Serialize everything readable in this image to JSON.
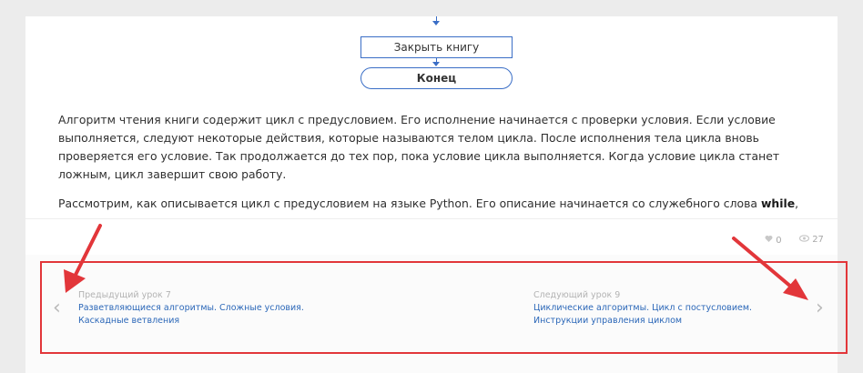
{
  "flowchart": {
    "close_book": "Закрыть книгу",
    "end": "Конец"
  },
  "article": {
    "paragraph1": "Алгоритм чтения книги содержит цикл с предусловием. Его исполнение начинается с проверки условия. Если условие выполняется, следуют некоторые действия, которые называются телом цикла. После исполнения тела цикла вновь проверяется его условие. Так продолжается до тех пор, пока условие цикла выполняется. Когда условие цикла станет ложным, цикл завершит свою работу.",
    "paragraph2_text": "Рассмотрим, как описывается цикл с предусловием на языке Python. Его описание начинается со служебного слова",
    "paragraph2_keyword": "while",
    "paragraph2_tail": ","
  },
  "meta": {
    "likes": "0",
    "views": "27"
  },
  "navigation": {
    "prev_caption": "Предыдущий урок 7",
    "prev_title_line1": "Разветвляющиеся алгоритмы. Сложные условия.",
    "prev_title_line2": "Каскадные ветвления",
    "next_caption": "Следующий урок 9",
    "next_title_line1": "Циклические алгоритмы. Цикл с постусловием.",
    "next_title_line2": "Инструкции управления циклом",
    "prev_icon": "chevron-left-icon",
    "next_icon": "chevron-right-icon"
  },
  "annotation": {
    "frame_color": "#e2363a",
    "arrow_color": "#e2363a"
  }
}
